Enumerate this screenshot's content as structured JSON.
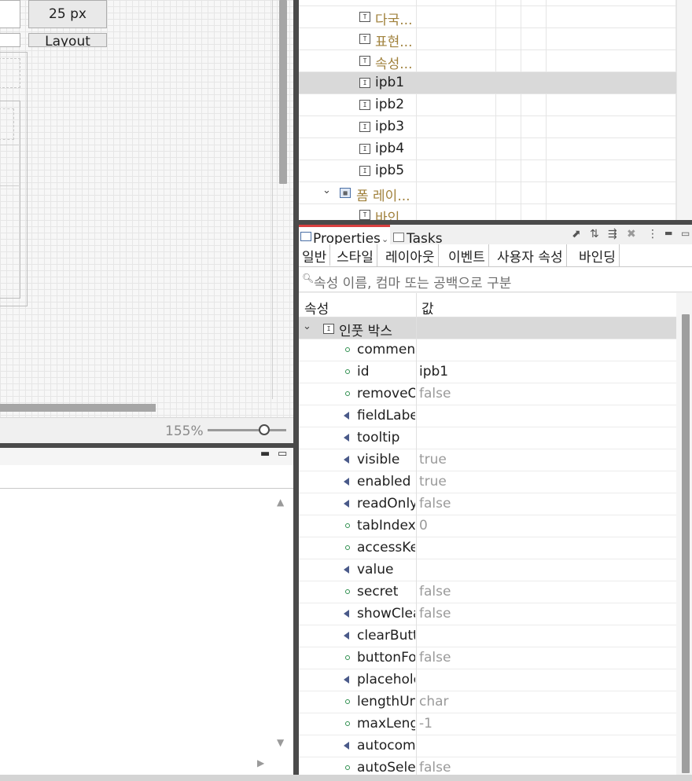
{
  "canvas": {
    "size_field": "25 px",
    "layout_button": "Layout",
    "zoom": "155%"
  },
  "outline": {
    "items": [
      {
        "label": "다국...",
        "icon": "text-component-icon",
        "kind": "group"
      },
      {
        "label": "표현...",
        "icon": "text-component-icon",
        "kind": "group"
      },
      {
        "label": "속성...",
        "icon": "text-component-icon",
        "kind": "group"
      },
      {
        "label": "ipb1",
        "icon": "input-box-icon",
        "kind": "item",
        "selected": true
      },
      {
        "label": "ipb2",
        "icon": "input-box-icon",
        "kind": "item"
      },
      {
        "label": "ipb3",
        "icon": "input-box-icon",
        "kind": "item"
      },
      {
        "label": "ipb4",
        "icon": "input-box-icon",
        "kind": "item"
      },
      {
        "label": "ipb5",
        "icon": "input-box-icon",
        "kind": "item"
      },
      {
        "label": "폼 레이...",
        "icon": "form-layout-icon",
        "kind": "group",
        "expanded": true
      },
      {
        "label": "바인",
        "icon": "text-component-icon",
        "kind": "group"
      }
    ]
  },
  "properties_view": {
    "tab_properties": "Properties",
    "tab_tasks": "Tasks",
    "subtabs": [
      "일반",
      "스타일",
      "레이아웃",
      "이벤트",
      "사용자 속성",
      "바인딩"
    ],
    "filter_placeholder": "속성 이름, 컴마 또는 공백으로 구분",
    "header_property": "속성",
    "header_value": "값",
    "category": "인풋 박스",
    "rows": [
      {
        "name": "comment",
        "value": "",
        "icon": "dot"
      },
      {
        "name": "id",
        "value": "ipb1",
        "icon": "dot",
        "dim": false
      },
      {
        "name": "removeO",
        "value": "false",
        "icon": "dot"
      },
      {
        "name": "fieldLabe",
        "value": "",
        "icon": "tri"
      },
      {
        "name": "tooltip",
        "value": "",
        "icon": "tri"
      },
      {
        "name": "visible",
        "value": "true",
        "icon": "tri"
      },
      {
        "name": "enabled",
        "value": "true",
        "icon": "tri"
      },
      {
        "name": "readOnly",
        "value": "false",
        "icon": "tri"
      },
      {
        "name": "tabIndex",
        "value": "0",
        "icon": "dot"
      },
      {
        "name": "accessKe",
        "value": "",
        "icon": "dot"
      },
      {
        "name": "value",
        "value": "",
        "icon": "tri"
      },
      {
        "name": "secret",
        "value": "false",
        "icon": "dot"
      },
      {
        "name": "showClea",
        "value": "false",
        "icon": "tri"
      },
      {
        "name": "clearButt",
        "value": "",
        "icon": "tri"
      },
      {
        "name": "buttonFo",
        "value": "false",
        "icon": "dot"
      },
      {
        "name": "placeholc",
        "value": "",
        "icon": "tri"
      },
      {
        "name": "lengthUn",
        "value": "char",
        "icon": "dot"
      },
      {
        "name": "maxLengt",
        "value": "-1",
        "icon": "dot"
      },
      {
        "name": "autocom",
        "value": "",
        "icon": "tri"
      },
      {
        "name": "autoSele",
        "value": "false",
        "icon": "dot"
      }
    ]
  },
  "colors": {
    "active_tab_accent": "#d94040",
    "group_text": "#a0813c",
    "selection": "#d9d9d9"
  }
}
